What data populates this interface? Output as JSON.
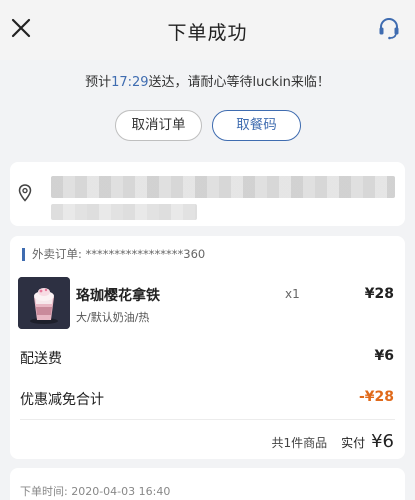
{
  "header": {
    "title": "下单成功"
  },
  "notice": {
    "prefix": "预计",
    "eta": "17:29",
    "suffix": "送达，请耐心等待luckin来临！"
  },
  "actions": {
    "cancel_label": "取消订单",
    "code_label": "取餐码"
  },
  "order": {
    "order_no": "外卖订单: *****************360",
    "item": {
      "name": "珞珈樱花拿铁",
      "spec": "大/默认奶油/热",
      "qty": "x1",
      "price": "¥28"
    },
    "delivery": {
      "label": "配送费",
      "value": "¥6"
    },
    "discount": {
      "label": "优惠减免合计",
      "value": "-¥28",
      "color": "#e06a1b"
    },
    "summary": {
      "count": "共1件商品",
      "paid_label": "实付",
      "paid_amount": "¥6"
    }
  },
  "footer": {
    "order_time": "下单时间: 2020-04-03 16:40"
  },
  "colors": {
    "accent": "#3f6cb0",
    "discount": "#e06a1b"
  }
}
